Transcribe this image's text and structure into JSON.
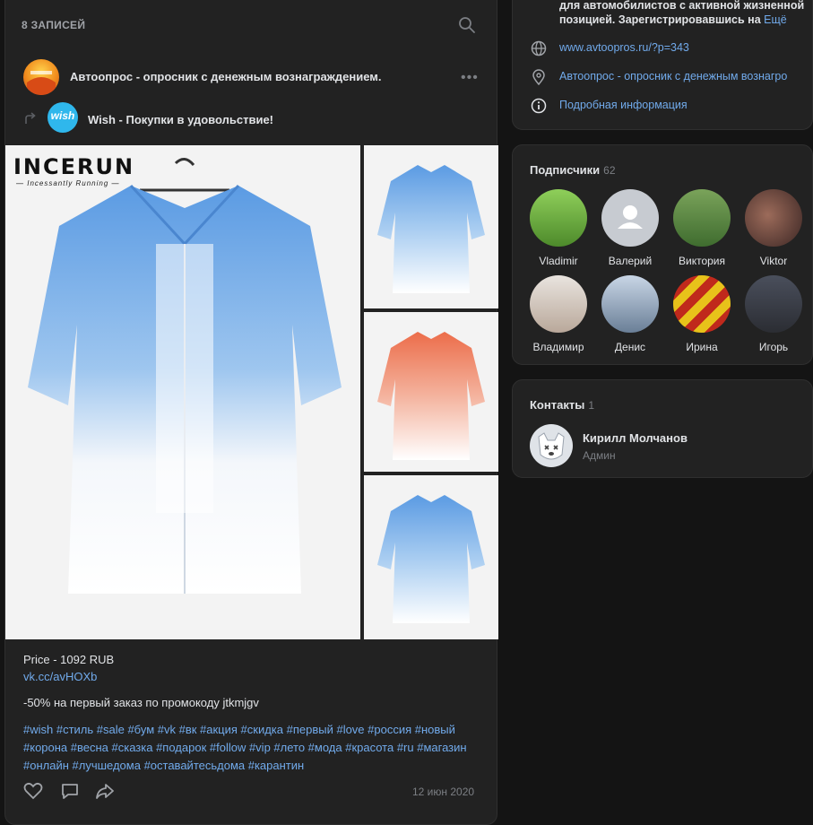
{
  "wall": {
    "title": "8 ЗАПИСЕЙ",
    "post": {
      "author": "Автоопрос - опросник с денежным вознаграждением.",
      "repost_from": "Wish - Покупки в удовольствие!",
      "wish_logo_text": "wish",
      "photo_brand": "INCERUN",
      "photo_brand_sub": "— Incessantly Running —",
      "price": "Price - 1092 RUB",
      "link": "vk.cc/avHOXb",
      "promo": "-50% на первый заказ по промокоду jtkmjgv",
      "hashtags": "#wish #стиль #sale #бум #vk #вк #акция #скидка #первый #love #россия #новый #корона #весна #сказка #подарок #follow #vip #лето #мода #красота #ru #магазин #онлайн #лучшедома #оставайтесьдома #карантин",
      "date": "12 июн 2020"
    }
  },
  "about": {
    "description": "для автомобилистов с активной жизненной позицией. Зарегистрировавшись на",
    "more": "Ещё",
    "website": "www.avtoopros.ru/?p=343",
    "address": "Автоопрос - опросник с денежным вознагро",
    "details": "Подробная информация"
  },
  "subscribers": {
    "title": "Подписчики",
    "count": "62",
    "members": [
      "Vladimir",
      "Валерий",
      "Виктория",
      "Viktor",
      "Владимир",
      "Денис",
      "Ирина",
      "Игорь"
    ]
  },
  "contacts": {
    "title": "Контакты",
    "count": "1",
    "name": "Кирилл Молчанов",
    "role": "Админ"
  },
  "colors": {
    "accent": "#71aaeb",
    "background": "#141414",
    "card": "#222222"
  }
}
